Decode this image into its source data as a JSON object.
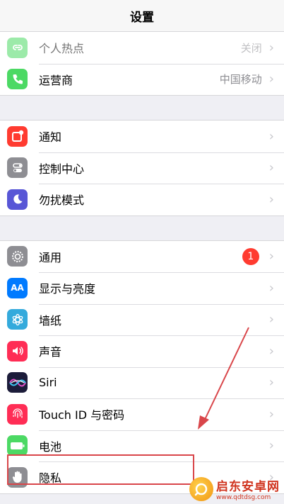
{
  "navbar": {
    "title": "设置"
  },
  "groups": [
    {
      "items": [
        {
          "label": "个人热点",
          "value": "关闭",
          "icon": "hotspot-icon",
          "color": "#4cd964"
        },
        {
          "label": "运营商",
          "value": "中国移动",
          "icon": "phone-icon",
          "color": "#4cd964"
        }
      ]
    },
    {
      "items": [
        {
          "label": "通知",
          "icon": "notifications-icon",
          "color": "#ff3b30"
        },
        {
          "label": "控制中心",
          "icon": "control-center-icon",
          "color": "#8e8e93"
        },
        {
          "label": "勿扰模式",
          "icon": "moon-icon",
          "color": "#5856d6"
        }
      ]
    },
    {
      "items": [
        {
          "label": "通用",
          "badge": "1",
          "icon": "gear-icon",
          "color": "#8e8e93"
        },
        {
          "label": "显示与亮度",
          "icon_text": "AA",
          "icon": "display-icon",
          "color": "#007aff"
        },
        {
          "label": "墙纸",
          "icon": "wallpaper-icon",
          "color": "#34aadc"
        },
        {
          "label": "声音",
          "icon": "speaker-icon",
          "color": "#ff2d55"
        },
        {
          "label": "Siri",
          "icon": "siri-icon",
          "color": "#1c1c3a"
        },
        {
          "label": "Touch ID 与密码",
          "icon": "fingerprint-icon",
          "color": "#ff2d55"
        },
        {
          "label": "电池",
          "icon": "battery-icon",
          "color": "#4cd964"
        },
        {
          "label": "隐私",
          "icon": "hand-icon",
          "color": "#8e8e93"
        }
      ]
    }
  ],
  "chevron": "›",
  "watermark": {
    "title": "启东安卓网",
    "url": "www.qdtdsg.com"
  }
}
